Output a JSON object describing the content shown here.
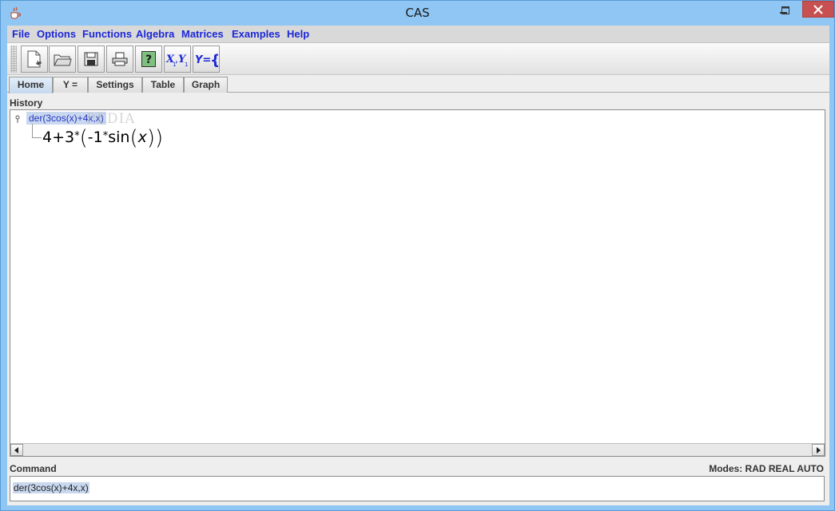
{
  "window": {
    "title": "CAS"
  },
  "menu": [
    "File",
    "Options",
    "Functions",
    "Algebra",
    "Matrices",
    "Examples",
    "Help"
  ],
  "toolbar": {
    "buttons": [
      "new-document-icon",
      "open-folder-icon",
      "save-disk-icon",
      "print-icon",
      "help-question-icon",
      "x1y1-icon",
      "y-equals-brace-icon"
    ],
    "x1y1_label": "X1,Y1",
    "yeq_label": "Y={"
  },
  "tabs": [
    "Home",
    "Y =",
    "Settings",
    "Table",
    "Graph"
  ],
  "history": {
    "label": "History",
    "entry_input": "der(3cos(x)+4x,x)",
    "result": {
      "p1": "4+3",
      "star1": "*",
      "open": "(",
      "p2": "-1",
      "star2": "*",
      "fn": "sin",
      "open2": "(",
      "var": "x",
      "close2": ")",
      "close": ")"
    },
    "watermark": "PEDIA"
  },
  "command": {
    "label": "Command",
    "modes": "Modes: RAD REAL AUTO",
    "value": "der(3cos(x)+4x,x)"
  },
  "colors": {
    "menu_text": "#1c28d6",
    "titlebar": "#8fc6f4",
    "close_button": "#c75050",
    "selection": "#c9d8ef"
  }
}
